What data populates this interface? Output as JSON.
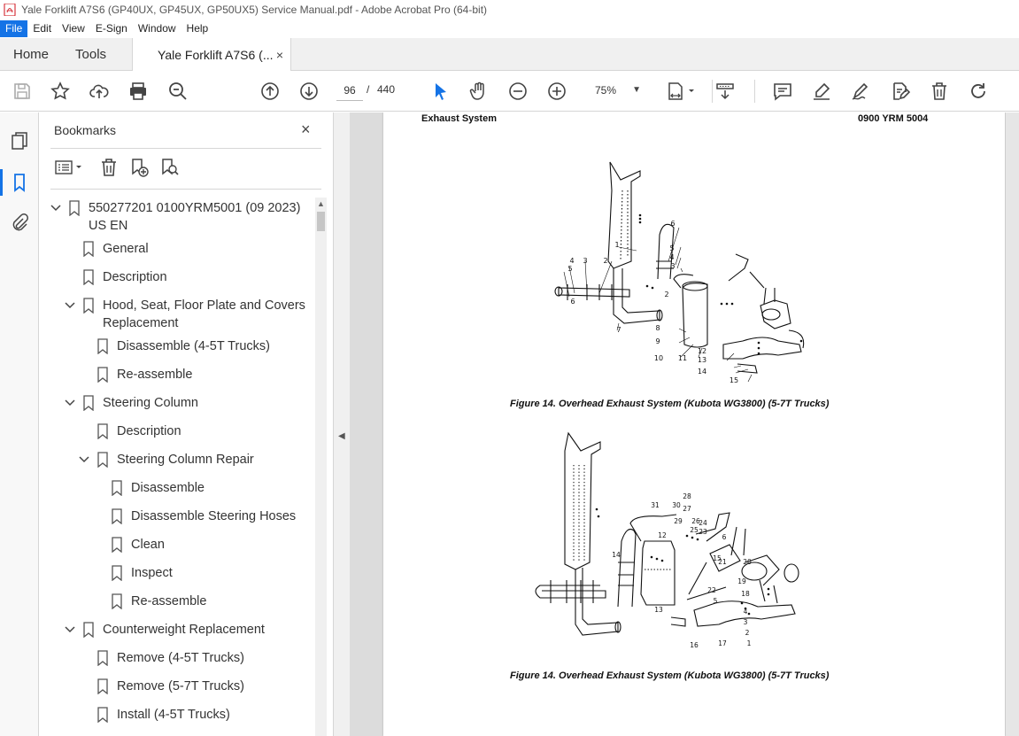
{
  "window": {
    "title": "Yale Forklift A7S6 (GP40UX, GP45UX, GP50UX5) Service Manual.pdf - Adobe Acrobat Pro (64-bit)"
  },
  "menu": [
    "File",
    "Edit",
    "View",
    "E-Sign",
    "Window",
    "Help"
  ],
  "tabs": {
    "home": "Home",
    "tools": "Tools",
    "document": "Yale Forklift A7S6 (...",
    "close": "×"
  },
  "toolbar": {
    "current_page": "96",
    "separator": "/",
    "total_pages": "440",
    "zoom": "75%"
  },
  "bookmarks": {
    "header": "Bookmarks",
    "close": "×",
    "items": [
      {
        "label": "550277201 0100YRM5001 (09 2023) US EN",
        "level": 0,
        "expanded": true
      },
      {
        "label": "General",
        "level": 1
      },
      {
        "label": "Description",
        "level": 1
      },
      {
        "label": "Hood, Seat, Floor Plate and Covers Replacement",
        "level": 1,
        "expanded": true
      },
      {
        "label": "Disassemble (4-5T Trucks)",
        "level": 2
      },
      {
        "label": "Re-assemble",
        "level": 2
      },
      {
        "label": "Steering Column",
        "level": 1,
        "expanded": true
      },
      {
        "label": "Description",
        "level": 2
      },
      {
        "label": "Steering Column Repair",
        "level": 2,
        "expanded": true
      },
      {
        "label": "Disassemble",
        "level": 3
      },
      {
        "label": "Disassemble Steering Hoses",
        "level": 3
      },
      {
        "label": "Clean",
        "level": 3
      },
      {
        "label": "Inspect",
        "level": 3
      },
      {
        "label": "Re-assemble",
        "level": 3
      },
      {
        "label": "Counterweight Replacement",
        "level": 1,
        "expanded": true
      },
      {
        "label": "Remove (4-5T Trucks)",
        "level": 2
      },
      {
        "label": "Remove (5-7T Trucks)",
        "level": 2
      },
      {
        "label": "Install (4-5T Trucks)",
        "level": 2
      }
    ]
  },
  "page": {
    "header_left": "Exhaust System",
    "header_right": "0900 YRM 5004",
    "figure1_caption": "Figure 14. Overhead Exhaust System (Kubota WG3800) (5-7T Trucks)",
    "figure2_caption": "Figure 14. Overhead Exhaust System (Kubota WG3800) (5-7T Trucks)",
    "figure1_callouts": [
      "1",
      "2",
      "3",
      "4",
      "5",
      "6",
      "4",
      "5",
      "6",
      "7",
      "8",
      "9",
      "10",
      "11",
      "12",
      "13",
      "14",
      "15",
      "3",
      "2"
    ],
    "figure2_callouts": [
      "28",
      "31",
      "30",
      "27",
      "29",
      "26",
      "24",
      "25",
      "23",
      "6",
      "12",
      "14",
      "15",
      "21",
      "20",
      "19",
      "18",
      "4",
      "3",
      "2",
      "1",
      "13",
      "16",
      "17",
      "5",
      "22"
    ]
  }
}
